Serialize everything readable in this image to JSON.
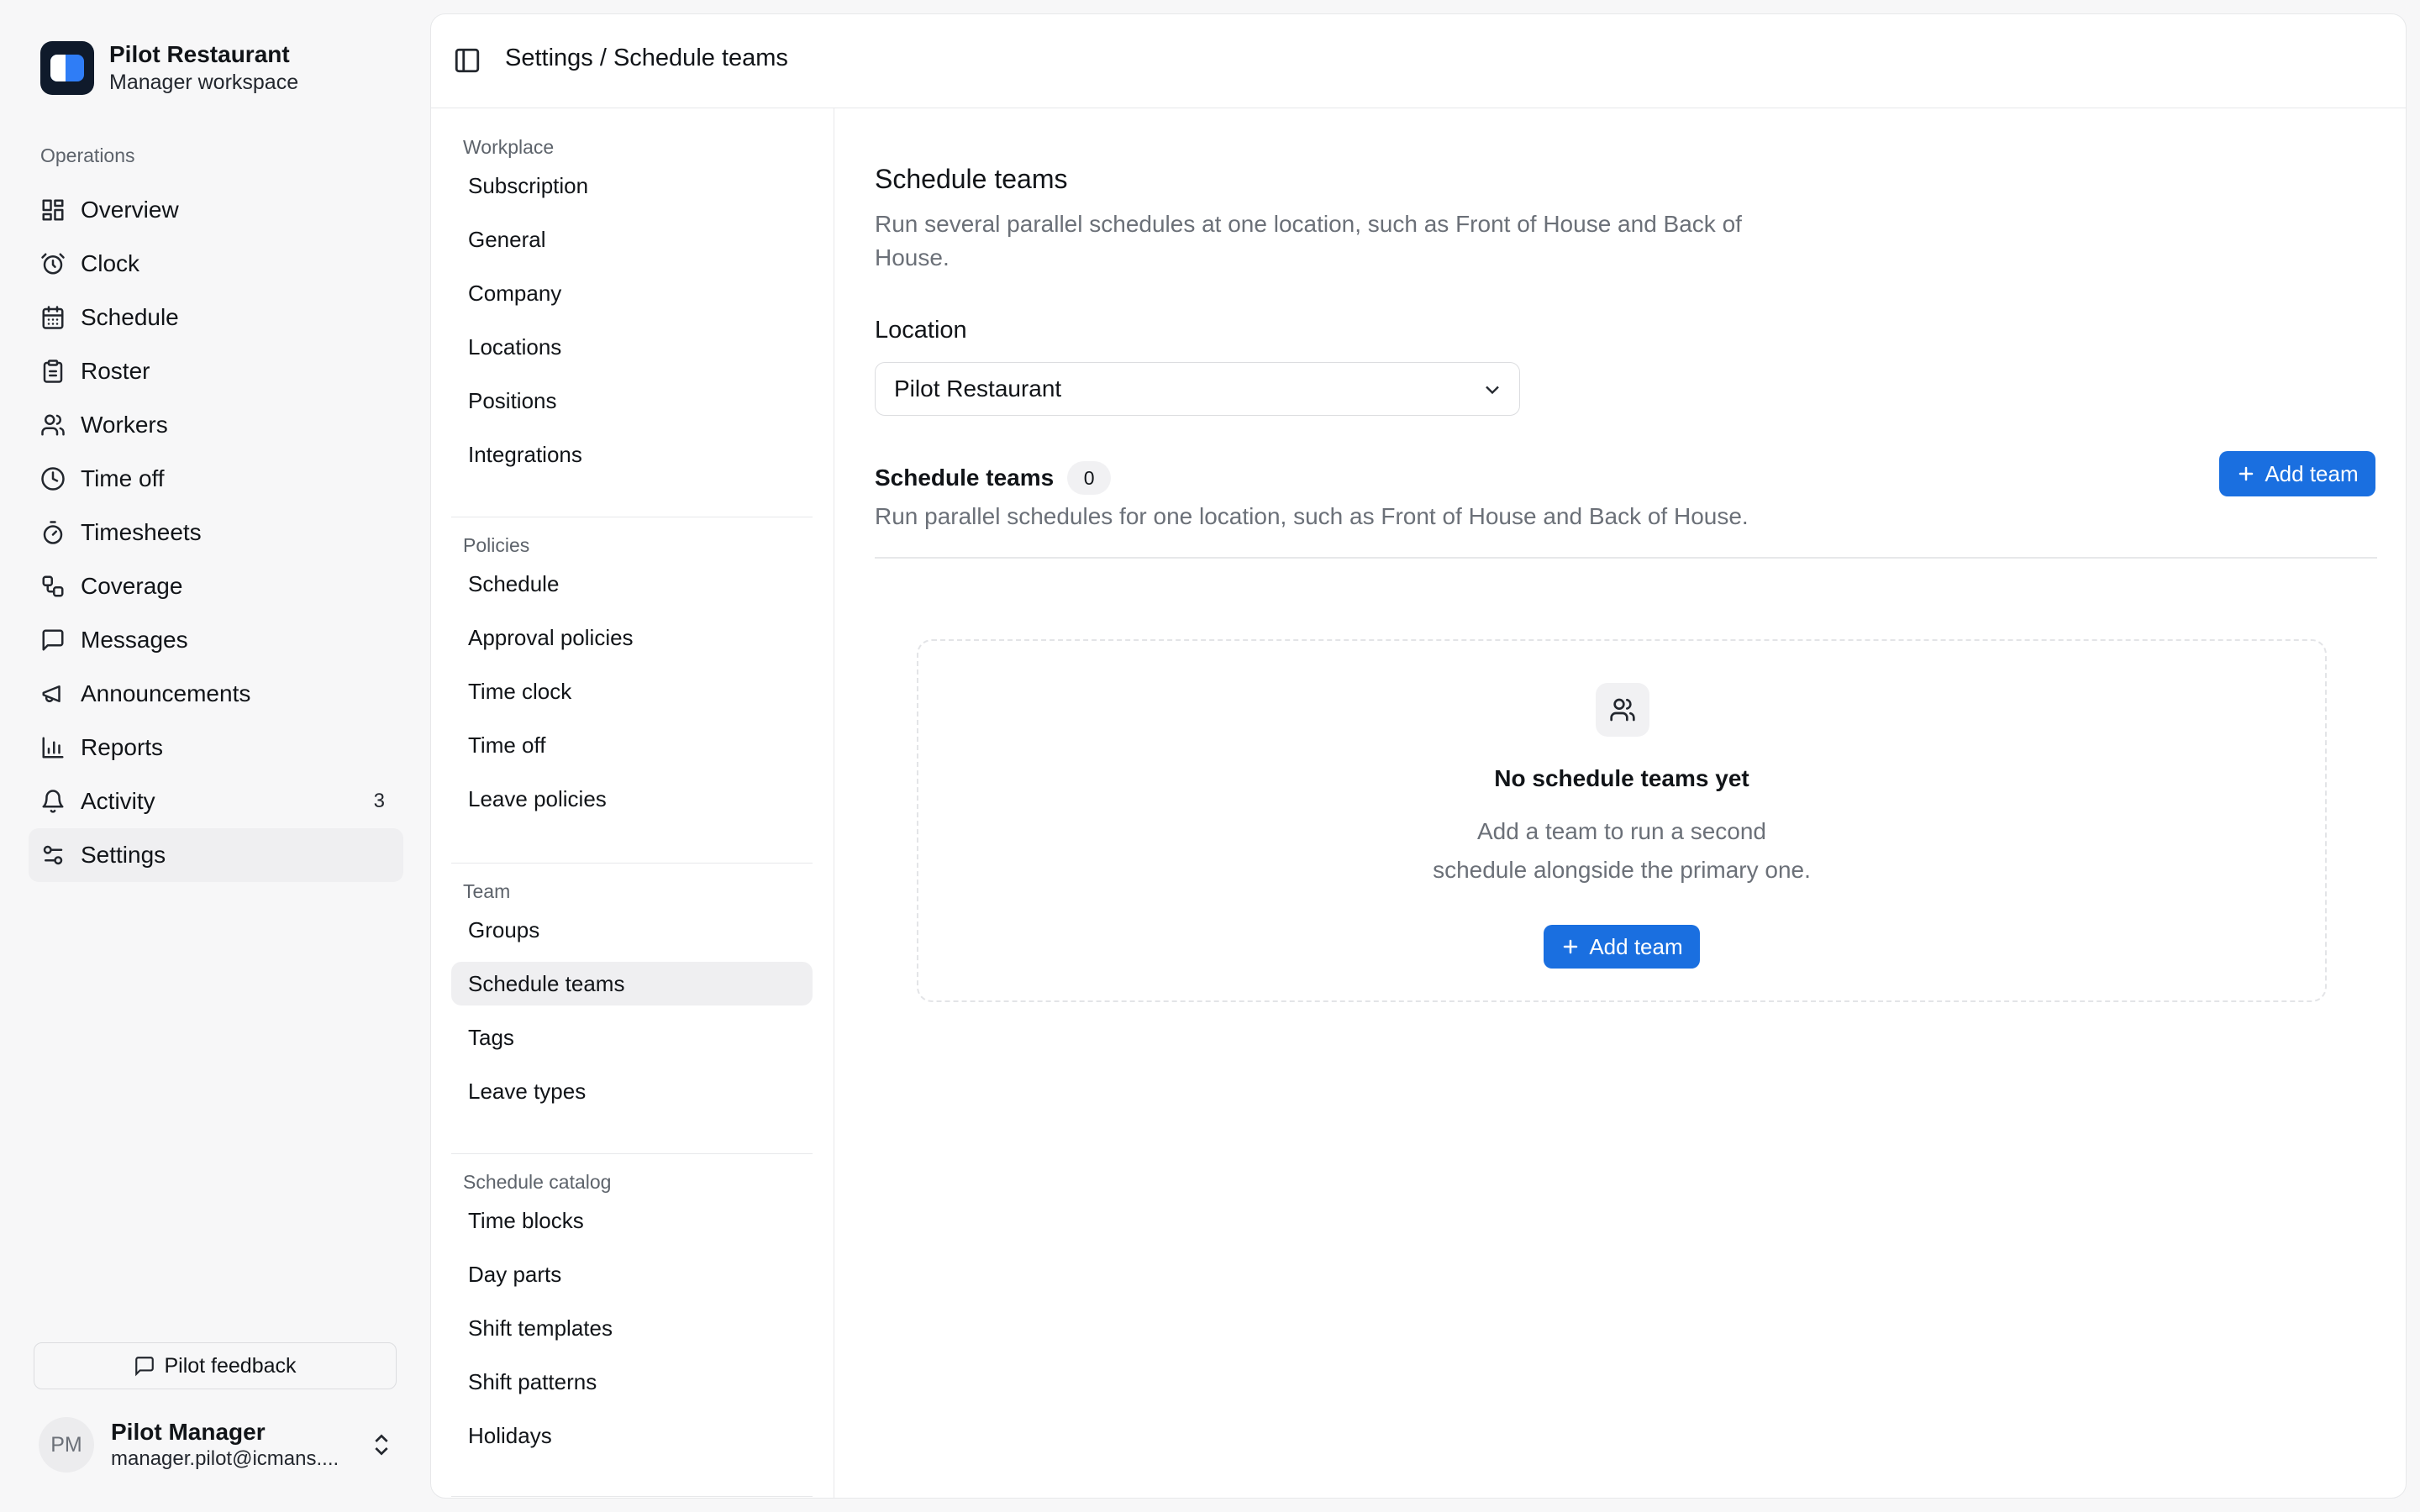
{
  "brand": {
    "title": "Pilot Restaurant",
    "subtitle": "Manager workspace"
  },
  "sidebar": {
    "section_label": "Operations",
    "items": [
      {
        "label": "Overview",
        "icon": "dashboard-icon"
      },
      {
        "label": "Clock",
        "icon": "alarm-clock-icon"
      },
      {
        "label": "Schedule",
        "icon": "calendar-icon"
      },
      {
        "label": "Roster",
        "icon": "clipboard-icon"
      },
      {
        "label": "Workers",
        "icon": "users-icon"
      },
      {
        "label": "Time off",
        "icon": "clock-icon"
      },
      {
        "label": "Timesheets",
        "icon": "stopwatch-icon"
      },
      {
        "label": "Coverage",
        "icon": "workflow-icon"
      },
      {
        "label": "Messages",
        "icon": "message-icon"
      },
      {
        "label": "Announcements",
        "icon": "megaphone-icon"
      },
      {
        "label": "Reports",
        "icon": "bar-chart-icon"
      },
      {
        "label": "Activity",
        "icon": "bell-icon",
        "badge": "3"
      },
      {
        "label": "Settings",
        "icon": "sliders-icon",
        "active": true
      }
    ],
    "feedback_label": "Pilot feedback",
    "user": {
      "initials": "PM",
      "name": "Pilot Manager",
      "email": "manager.pilot@icmans...."
    }
  },
  "header": {
    "breadcrumb": "Settings / Schedule teams"
  },
  "subnav": {
    "groups": [
      {
        "label": "Workplace",
        "items": [
          "Subscription",
          "General",
          "Company",
          "Locations",
          "Positions",
          "Integrations"
        ]
      },
      {
        "label": "Policies",
        "items": [
          "Schedule",
          "Approval policies",
          "Time clock",
          "Time off",
          "Leave policies"
        ]
      },
      {
        "label": "Team",
        "items": [
          "Groups",
          "Schedule teams",
          "Tags",
          "Leave types"
        ],
        "active": "Schedule teams"
      },
      {
        "label": "Schedule catalog",
        "items": [
          "Time blocks",
          "Day parts",
          "Shift templates",
          "Shift patterns",
          "Holidays"
        ]
      }
    ]
  },
  "main": {
    "title": "Schedule teams",
    "description": "Run several parallel schedules at one location, such as Front of House and Back of House.",
    "location_label": "Location",
    "location_value": "Pilot Restaurant",
    "teams_title": "Schedule teams",
    "teams_count": "0",
    "teams_description": "Run parallel schedules for one location, such as Front of House and Back of House.",
    "add_team_label": "Add team",
    "empty": {
      "title": "No schedule teams yet",
      "line1": "Add a team to run a second",
      "line2": "schedule alongside the primary one.",
      "button_label": "Add team"
    }
  },
  "colors": {
    "accent": "#1a6fe0",
    "active_bg": "#efeff1"
  }
}
